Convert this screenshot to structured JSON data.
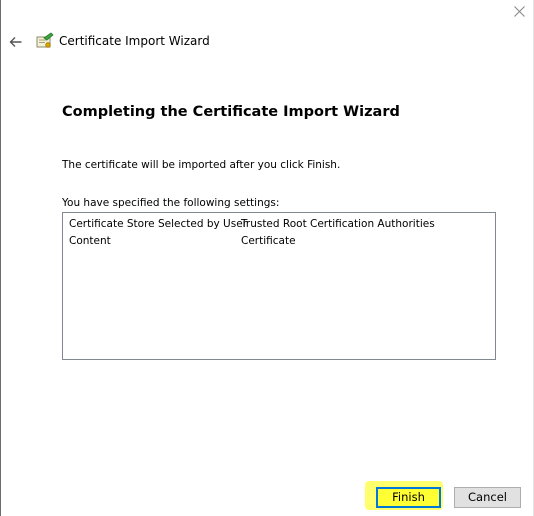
{
  "window": {
    "title": "Certificate Import Wizard",
    "close_icon": "close-icon",
    "back_icon": "back-arrow-icon",
    "wizard_icon": "certificate-icon"
  },
  "page": {
    "heading": "Completing the Certificate Import Wizard",
    "info_text": "The certificate will be imported after you click Finish.",
    "settings_label": "You have specified the following settings:"
  },
  "settings": [
    {
      "key": "Certificate Store Selected by User",
      "value": "Trusted Root Certification Authorities"
    },
    {
      "key": "Content",
      "value": "Certificate"
    }
  ],
  "buttons": {
    "finish": "Finish",
    "cancel": "Cancel"
  },
  "colors": {
    "highlight": "#ffff66",
    "focus_border": "#0078d7"
  }
}
